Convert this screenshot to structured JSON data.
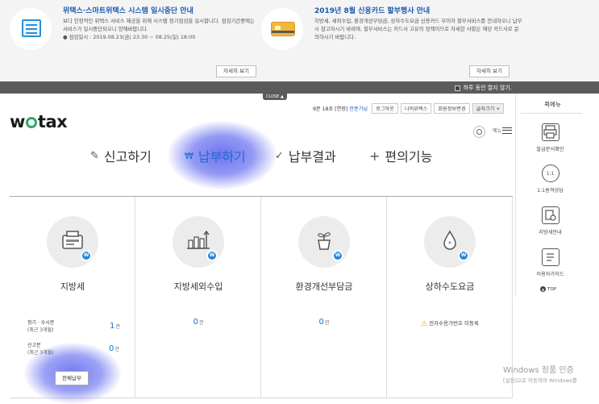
{
  "notices": [
    {
      "title": "위택스·스마트위택스 시스템 일시중단 안내",
      "body": "보다 안정적인 위택스 서비스 제공을 위해 시스템 정기점검을 실시합니다. 점검기간중에는 서비스가 일시중단되오니 양해바랍니다.",
      "period": "● 점검일시 : 2019.08.23(금) 23:30 ~ 08.25(일) 18:00",
      "button": "자세히 보기",
      "icon": "document-icon"
    },
    {
      "title": "2019년 8월 신용카드 할부행사 안내",
      "body": "지방세, 세외수입, 환경개선부담금, 상하수도요금 신용카드 무이자 할부서비스를 안내하오니 납부 시 참고하시기 바라며, 할부서비스는 카드사 고유의 정책이므로 자세한 사항은 해당 카드사로 문의하시기 바랍니다.",
      "button": "자세히 보기",
      "icon": "credit-card-icon"
    }
  ],
  "darkbar": {
    "day_close_label": "하루 동안 열지 않기."
  },
  "close_tab": "CLOSE ▲",
  "util": {
    "user_prefix": "9분 18초 [연장]",
    "user_name": "안준기님",
    "buttons": [
      "로그아웃",
      "나의위택스",
      "회원정보변경",
      "글자크기 +"
    ]
  },
  "logo": {
    "left": "w",
    "right": "tax"
  },
  "menu_label": "메뉴",
  "gnb": [
    {
      "label": "신고하기",
      "icon": "pencil-icon",
      "glyph": "✎"
    },
    {
      "label": "납부하기",
      "icon": "won-icon",
      "glyph": "₩"
    },
    {
      "label": "납부결과",
      "icon": "check-icon",
      "glyph": "✓"
    },
    {
      "label": "편의기능",
      "icon": "plus-icon",
      "glyph": "+"
    }
  ],
  "cards": [
    {
      "title": "지방세",
      "icon": "tax-machine-icon",
      "rows": [
        {
          "label": "정기 · 수시분",
          "sub": "(최근 3개월)",
          "count": "1",
          "unit": "건"
        },
        {
          "label": "신고분",
          "sub": "(최근 3개월)",
          "count": "0",
          "unit": "건"
        }
      ],
      "button": "전체납부"
    },
    {
      "title": "지방세외수입",
      "icon": "building-chart-icon",
      "count": "0",
      "unit": "건"
    },
    {
      "title": "환경개선부담금",
      "icon": "plant-pot-icon",
      "count": "0",
      "unit": "건"
    },
    {
      "title": "상하수도요금",
      "icon": "water-drop-icon",
      "warning": "전자수용가번호 미등록"
    }
  ],
  "badge_letter": "W",
  "quick": {
    "title": "퀵메뉴",
    "items": [
      {
        "label": "발급문서확인",
        "icon": "printer-icon"
      },
      {
        "label": "1:1원격상담",
        "icon": "remote-support-icon"
      },
      {
        "label": "지방세안내",
        "icon": "tax-guide-icon"
      },
      {
        "label": "이용자가이드",
        "icon": "user-guide-icon"
      }
    ],
    "top_label": "TOP"
  },
  "watermark": {
    "line1": "Windows 정품 인증",
    "line2": "[설정]으로 이동하여 Windows를"
  }
}
